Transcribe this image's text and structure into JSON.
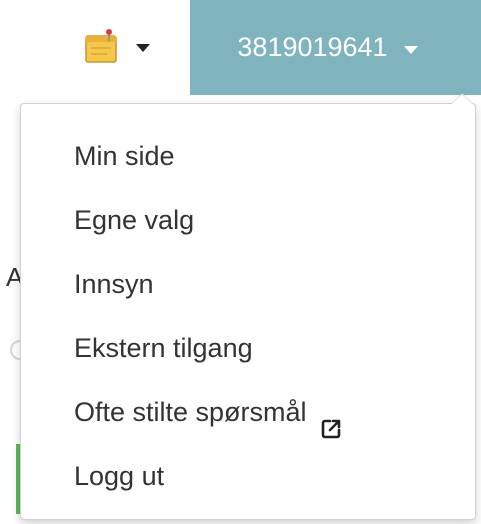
{
  "header": {
    "notes_icon": "notes-icon",
    "user_id": "3819019641"
  },
  "menu": {
    "items": [
      {
        "label": "Min side"
      },
      {
        "label": "Egne valg"
      },
      {
        "label": "Innsyn"
      },
      {
        "label": "Ekstern tilgang"
      },
      {
        "label": "Ofte stilte spørsmål",
        "icon": "external-link-icon"
      },
      {
        "label": "Logg ut"
      }
    ]
  },
  "background": {
    "partial_letter": "A"
  },
  "colors": {
    "topbar": "#7fb3bd",
    "menu_text": "#333333",
    "accent_green": "#5cb85c"
  }
}
